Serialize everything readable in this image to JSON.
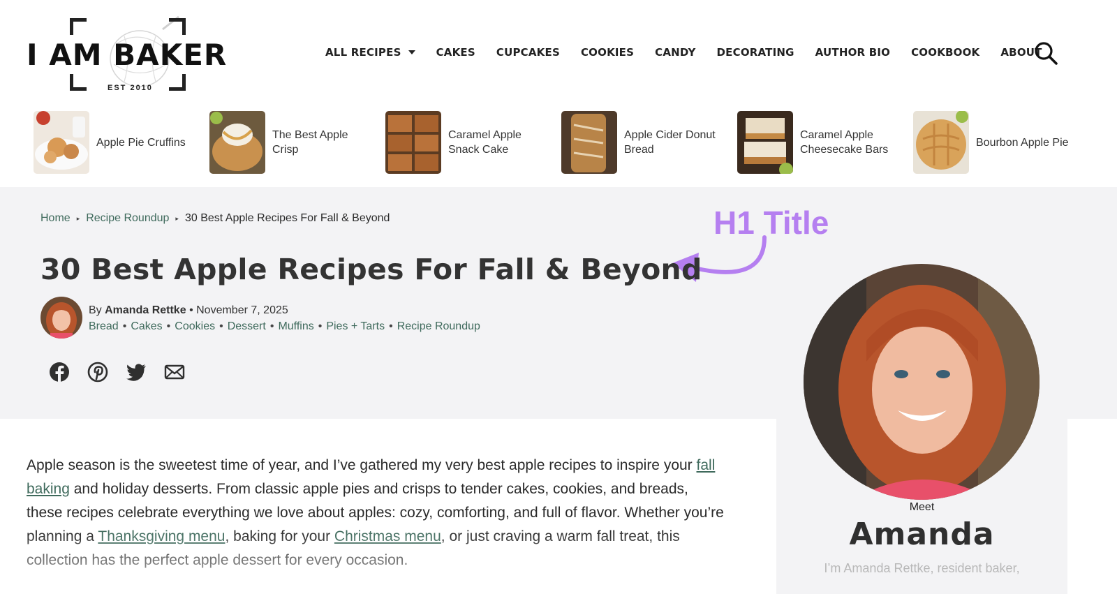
{
  "site": {
    "logo_text": "I AM BAKER",
    "logo_est": "EST 2010"
  },
  "nav": {
    "items": [
      {
        "label": "ALL RECIPES",
        "has_dropdown": true
      },
      {
        "label": "CAKES"
      },
      {
        "label": "CUPCAKES"
      },
      {
        "label": "COOKIES"
      },
      {
        "label": "CANDY"
      },
      {
        "label": "DECORATING"
      },
      {
        "label": "AUTHOR BIO"
      },
      {
        "label": "COOKBOOK"
      },
      {
        "label": "ABOUT"
      }
    ],
    "search_icon": "search-icon"
  },
  "recipe_strip": [
    {
      "title": "Apple Pie Cruffins"
    },
    {
      "title": "The Best Apple Crisp"
    },
    {
      "title": "Caramel Apple Snack Cake"
    },
    {
      "title": "Apple Cider Donut Bread"
    },
    {
      "title": "Caramel Apple Cheesecake Bars"
    },
    {
      "title": "Bourbon Apple Pie"
    }
  ],
  "breadcrumb": {
    "home": "Home",
    "section": "Recipe Roundup",
    "current": "30 Best Apple Recipes For Fall & Beyond"
  },
  "annotation": {
    "label": "H1 Title",
    "color": "#b57ff0"
  },
  "article": {
    "title": "30 Best Apple Recipes For Fall & Beyond",
    "by_prefix": "By",
    "author": "Amanda Rettke",
    "date_sep": "•",
    "date": "November 7, 2025",
    "categories": [
      "Bread",
      "Cakes",
      "Cookies",
      "Dessert",
      "Muffins",
      "Pies + Tarts",
      "Recipe Roundup"
    ],
    "share_icons": [
      "facebook-icon",
      "pinterest-icon",
      "twitter-icon",
      "email-icon"
    ],
    "intro": {
      "p1": "Apple season is the sweetest time of year, and I’ve gathered my very best apple recipes to inspire your ",
      "link1": "fall baking",
      "p2": " and holiday desserts. From classic apple pies and crisps to tender cakes, cookies, and breads, these recipes celebrate everything we love about apples: cozy, comforting, and full of flavor. Whether you’re planning a ",
      "link2": "Thanksgiving menu",
      "p3": ", baking for your ",
      "link3": "Christmas menu",
      "p4": ", or just craving a warm fall treat, this collection has the perfect apple dessert for every occasion."
    }
  },
  "sidebar": {
    "meet": "Meet",
    "name": "Amanda",
    "bio_start": "I’m Amanda Rettke, resident baker,"
  },
  "colors": {
    "link_green": "#3f6a5c",
    "hero_bg": "#f3f3f5",
    "text": "#2a2a2a"
  }
}
